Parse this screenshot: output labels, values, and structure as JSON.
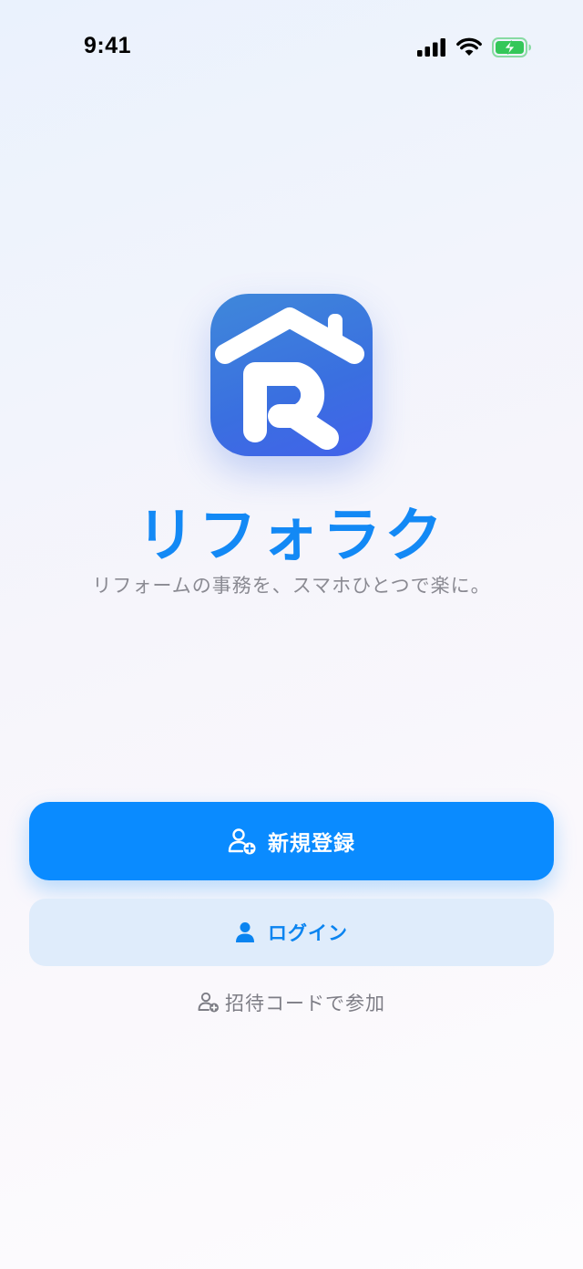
{
  "status_bar": {
    "time": "9:41",
    "icons": [
      "cellular-signal-icon",
      "wifi-icon",
      "battery-charging-icon"
    ]
  },
  "brand": {
    "app_icon": "house-r-logo-icon",
    "name": "リフォラク",
    "tagline": "リフォームの事務を、スマホひとつで楽に。"
  },
  "actions": {
    "signup": {
      "label": "新規登録",
      "icon": "person-add-icon"
    },
    "login": {
      "label": "ログイン",
      "icon": "person-icon"
    },
    "invite": {
      "label": "招待コードで参加",
      "icon": "person-add-icon"
    }
  },
  "colors": {
    "accent": "#0a8bff",
    "brand_text": "#1389f5",
    "login_bg": "#dfecfb",
    "battery_green": "#34c759"
  }
}
